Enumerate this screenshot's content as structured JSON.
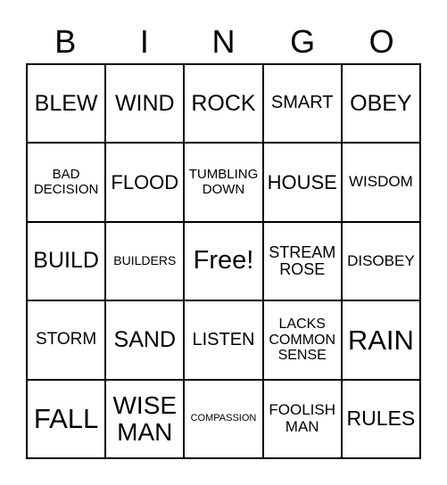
{
  "header": {
    "letters": [
      "B",
      "I",
      "N",
      "G",
      "O"
    ]
  },
  "board": {
    "rows": [
      [
        "BLEW",
        "WIND",
        "ROCK",
        "SMART",
        "OBEY"
      ],
      [
        "BAD\nDECISION",
        "FLOOD",
        "TUMBLING\nDOWN",
        "HOUSE",
        "WISDOM"
      ],
      [
        "BUILD",
        "BUILDERS",
        "Free!",
        "STREAM\nROSE",
        "DISOBEY"
      ],
      [
        "STORM",
        "SAND",
        "LISTEN",
        "LACKS\nCOMMON\nSENSE",
        "RAIN"
      ],
      [
        "FALL",
        "WISE\nMAN",
        "COMPASSION",
        "FOOLISH\nMAN",
        "RULES"
      ]
    ],
    "free_space": {
      "row": 2,
      "col": 2
    }
  }
}
